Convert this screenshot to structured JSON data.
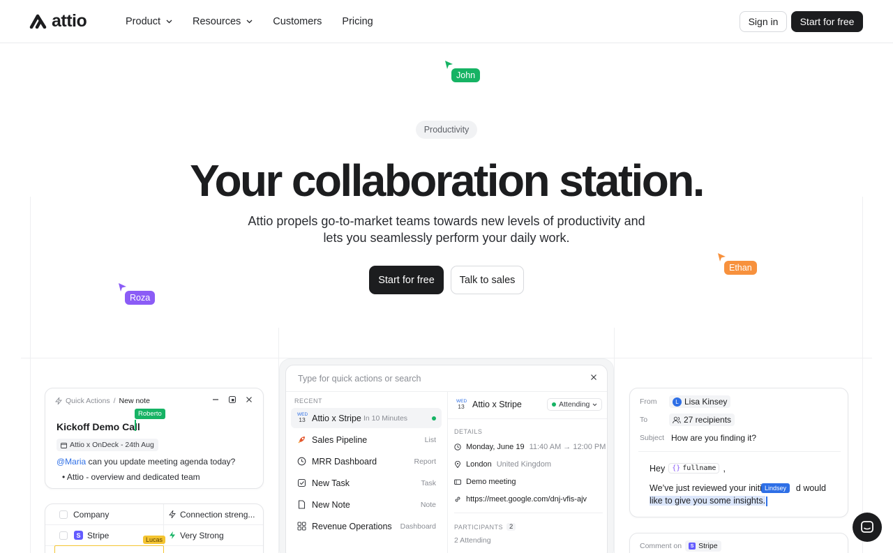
{
  "nav": {
    "logo": "attio",
    "links": [
      {
        "label": "Product",
        "dropdown": true
      },
      {
        "label": "Resources",
        "dropdown": true
      },
      {
        "label": "Customers",
        "dropdown": false
      },
      {
        "label": "Pricing",
        "dropdown": false
      }
    ],
    "signin": "Sign in",
    "start": "Start for free"
  },
  "cursors": {
    "john": {
      "name": "John",
      "color": "#16b364"
    },
    "ethan": {
      "name": "Ethan",
      "color": "#f7913d"
    },
    "roza": {
      "name": "Roza",
      "color": "#8b5cf6"
    }
  },
  "hero": {
    "pill": "Productivity",
    "headline": "Your collaboration station.",
    "sub_line1": "Attio propels go-to-market teams towards new levels of productivity and",
    "sub_line2": "lets you seamlessly perform your daily work.",
    "cta_primary": "Start for free",
    "cta_secondary": "Talk to sales"
  },
  "note_card": {
    "crumb1": "Quick Actions",
    "crumb_sep": "/",
    "crumb2": "New note",
    "collaborator": "Roberto",
    "title": "Kickoff Demo Call",
    "date_chip": "Attio x OnDeck - 24th Aug",
    "mention": "@Maria",
    "line_rest": " can you update meeting agenda today?",
    "bullet": "Attio - overview and dedicated team"
  },
  "table_card": {
    "col1": "Company",
    "col2": "Connection streng...",
    "row1_company": "Stripe",
    "row1_strength": "Very Strong",
    "collaborator": "Lucas"
  },
  "palette": {
    "placeholder": "Type for quick actions or search",
    "recent_label": "RECENT",
    "items": [
      {
        "title": "Attio x Stripe",
        "meta": "In 10 Minutes",
        "right": ""
      },
      {
        "title": "Sales Pipeline",
        "right": "List"
      },
      {
        "title": "MRR Dashboard",
        "right": "Report"
      },
      {
        "title": "New Task",
        "right": "Task"
      },
      {
        "title": "New Note",
        "right": "Note"
      },
      {
        "title": "Revenue Operations",
        "right": "Dashboard"
      }
    ],
    "cal_day": "WED",
    "cal_num": "13",
    "event_title": "Attio x Stripe",
    "attending": "Attending",
    "details_label": "DETAILS",
    "date": "Monday, June 19",
    "time": "11:40 AM → 12:00 PM",
    "city": "London",
    "country": "United Kingdom",
    "meeting": "Demo meeting",
    "link": "https://meet.google.com/dnj-vfis-ajv",
    "participants_label": "PARTICIPANTS",
    "participants_count": "2",
    "attending_count": "2 Attending"
  },
  "email_card": {
    "from_label": "From",
    "from": "Lisa Kinsey",
    "from_initial": "L",
    "to_label": "To",
    "to": "27 recipients",
    "subject_label": "Subject",
    "subject": "How are you finding it?",
    "greeting": "Hey",
    "var": "fullname",
    "comma": ",",
    "body1a": "We’ve just reviewed your initia",
    "body1b": "d would",
    "body2": "like to give you some insights.",
    "collaborator": "Lindsey"
  },
  "comment_card": {
    "label": "Comment on",
    "company": "Stripe"
  }
}
